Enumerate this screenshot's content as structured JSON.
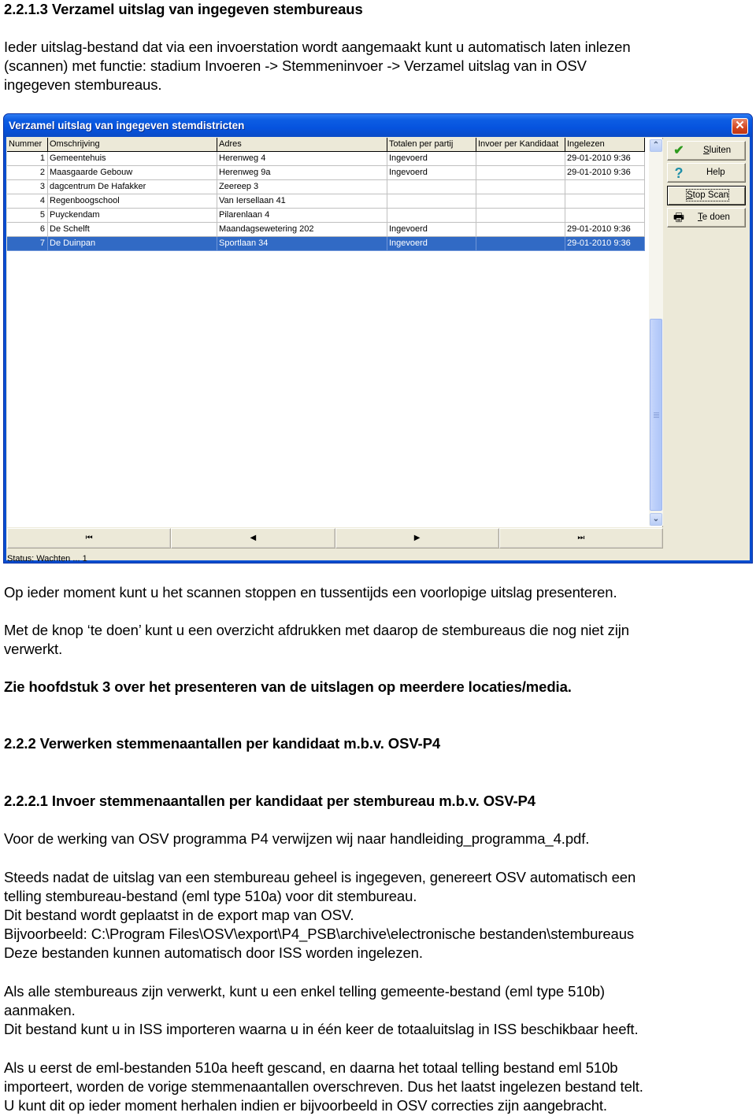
{
  "document": {
    "heading_1": "2.2.1.3 Verzamel uitslag van ingegeven stembureaus",
    "intro_lines": [
      "Ieder uitslag-bestand dat via een invoerstation wordt aangemaakt kunt u automatisch laten inlezen",
      "(scannen) met functie: stadium Invoeren -> Stemmeninvoer -> Verzamel uitslag van in OSV",
      "ingegeven stembureaus."
    ],
    "para_stop": "Op ieder moment kunt u het scannen stoppen en tussentijds een voorlopige uitslag presenteren.",
    "para_tedoen_lines": [
      "Met de knop ‘te doen’ kunt u een overzicht afdrukken met daarop de stembureaus die nog niet zijn",
      "verwerkt."
    ],
    "para_chapter3": "Zie hoofdstuk 3 over het presenteren van de uitslagen op meerdere locaties/media.",
    "heading_2": "2.2.2 Verwerken stemmenaantallen per kandidaat  m.b.v. OSV-P4",
    "heading_3": "2.2.2.1 Invoer stemmenaantallen per kandidaat per stembureau m.b.v. OSV-P4",
    "para_p4": "Voor de werking van OSV programma P4 verwijzen wij naar handleiding_programma_4.pdf.",
    "para_510a_lines": [
      "Steeds nadat de uitslag van een stembureau geheel is ingegeven, genereert OSV automatisch een",
      "telling stembureau-bestand (eml type 510a) voor dit stembureau.",
      "Dit bestand wordt geplaatst in de export map van OSV.",
      "Bijvoorbeeld: C:\\Program Files\\OSV\\export\\P4_PSB\\archive\\electronische bestanden\\stembureaus",
      "Deze bestanden kunnen automatisch door ISS worden ingelezen."
    ],
    "para_510b_lines": [
      "Als alle stembureaus zijn verwerkt, kunt u een enkel telling gemeente-bestand (eml type 510b)",
      "aanmaken.",
      "Dit bestand kunt u in ISS importeren waarna u in één keer de totaaluitslag in ISS beschikbaar heeft."
    ],
    "para_overwrite_lines": [
      "Als u eerst de eml-bestanden 510a heeft gescand, en daarna het totaal telling bestand eml 510b",
      "importeert, worden de vorige stemmenaantallen overschreven. Dus het laatst ingelezen bestand telt.",
      "U kunt dit op ieder moment herhalen indien er bijvoorbeeld in OSV correcties zijn aangebracht."
    ]
  },
  "dialog": {
    "title": "Verzamel uitslag van ingegeven stemdistricten",
    "close_icon": "close-icon",
    "columns": [
      "Nummer",
      "Omschrijving",
      "Adres",
      "Totalen per partij",
      "Invoer per Kandidaat",
      "Ingelezen"
    ],
    "rows": [
      [
        "1",
        "Gemeentehuis",
        "Herenweg 4",
        "Ingevoerd",
        "",
        "29-01-2010  9:36"
      ],
      [
        "2",
        "Maasgaarde Gebouw",
        "Herenweg 9a",
        "Ingevoerd",
        "",
        "29-01-2010  9:36"
      ],
      [
        "3",
        "dagcentrum De Hafakker",
        "Zeereep 3",
        "",
        "",
        ""
      ],
      [
        "4",
        "Regenboogschool",
        "Van Iersellaan 41",
        "",
        "",
        ""
      ],
      [
        "5",
        "Puyckendam",
        "Pilarenlaan 4",
        "",
        "",
        ""
      ],
      [
        "6",
        "De Schelft",
        "Maandagsewetering 202",
        "Ingevoerd",
        "",
        "29-01-2010  9:36"
      ],
      [
        "7",
        "De Duinpan",
        "Sportlaan 34",
        "Ingevoerd",
        "",
        "29-01-2010  9:36"
      ]
    ],
    "selected_row": 7,
    "nav": {
      "first": "⏮",
      "prev": "◀",
      "next": "▶",
      "last": "⏭"
    },
    "status": "Status: Wachten ... 1",
    "buttons": {
      "sluiten": {
        "label_u": "S",
        "label_rest": "luiten",
        "icon": "checkmark-icon"
      },
      "help": {
        "label": "Help",
        "icon": "question-icon"
      },
      "stop_scan": {
        "label_u": "S",
        "label_rest": "top Scan"
      },
      "te_doen": {
        "label_u": "T",
        "label_rest": "e doen",
        "icon": "printer-icon"
      }
    },
    "colors": {
      "titlebar": "#0a4ecf",
      "selection": "#316ac5",
      "face": "#ece9d8"
    }
  }
}
